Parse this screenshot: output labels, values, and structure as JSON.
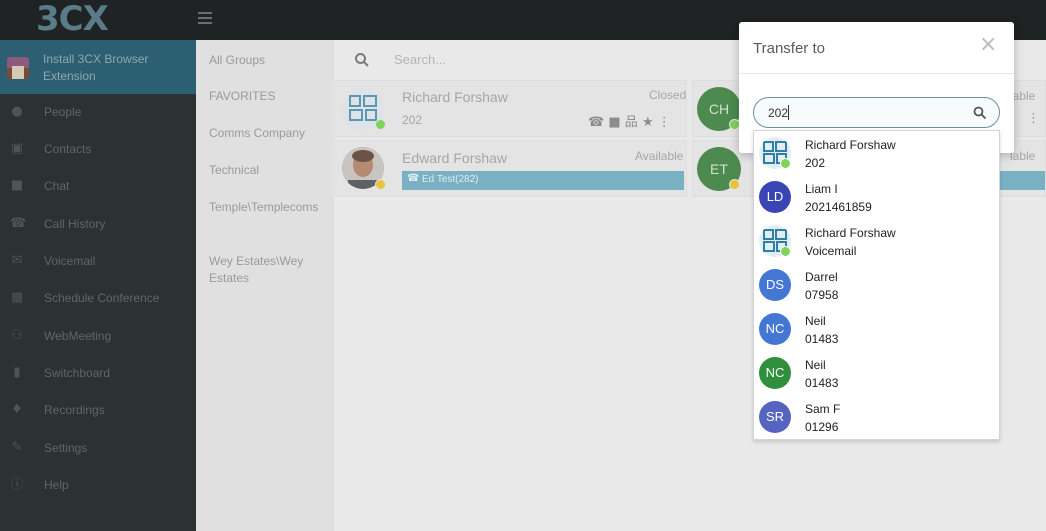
{
  "app": {
    "logo": "3CX"
  },
  "sidebar": {
    "promo": "Install 3CX Browser Extension",
    "items": [
      {
        "label": "People",
        "icon": "person-icon"
      },
      {
        "label": "Contacts",
        "icon": "contacts-icon"
      },
      {
        "label": "Chat",
        "icon": "chat-icon"
      },
      {
        "label": "Call History",
        "icon": "phone-icon"
      },
      {
        "label": "Voicemail",
        "icon": "voicemail-icon"
      },
      {
        "label": "Schedule Conference",
        "icon": "calendar-icon"
      },
      {
        "label": "WebMeeting",
        "icon": "webmeeting-icon"
      },
      {
        "label": "Switchboard",
        "icon": "switchboard-icon"
      },
      {
        "label": "Recordings",
        "icon": "microphone-icon"
      },
      {
        "label": "Settings",
        "icon": "wrench-icon"
      },
      {
        "label": "Help",
        "icon": "info-icon"
      }
    ]
  },
  "groups": {
    "items": [
      {
        "label": "All Groups"
      },
      {
        "label": "FAVORITES"
      },
      {
        "label": "Comms Company"
      },
      {
        "label": "Technical"
      },
      {
        "label": "Temple\\Templecoms"
      },
      {
        "label": "Wey Estates\\Wey Estates"
      }
    ]
  },
  "main": {
    "search_placeholder": "Search...",
    "cards": [
      {
        "name": "Richard Forshaw",
        "ext": "202",
        "status": "Closed"
      },
      {
        "name": "Edward Forshaw",
        "status": "Available",
        "call": "Ed Test(282)"
      },
      {
        "initials": "CH",
        "status": "lable"
      },
      {
        "initials": "ET",
        "status": "lable"
      }
    ]
  },
  "colors": {
    "accent": "#2d5f73",
    "available": "#7fd35a",
    "busy": "#e8c23a"
  },
  "modal": {
    "title": "Transfer to",
    "close": "×",
    "input_value": "202",
    "results": [
      {
        "line1": "Richard Forshaw",
        "line2": "202"
      },
      {
        "initials": "LD",
        "line1": "Liam I",
        "line2": "2021461859",
        "color": "#3a45b5"
      },
      {
        "line1": "Richard Forshaw",
        "line2": "Voicemail"
      },
      {
        "initials": "DS",
        "line1": "Darrel",
        "line2": "07958",
        "color": "#4477d4"
      },
      {
        "initials": "NC",
        "line1": "Neil",
        "line2": "01483",
        "color": "#4477d4"
      },
      {
        "initials": "NC",
        "line1": "Neil",
        "line2": "01483",
        "color": "#2f8f3a"
      },
      {
        "initials": "SR",
        "line1": "Sam F",
        "line2": "01296",
        "color": "#5564bf"
      }
    ]
  }
}
